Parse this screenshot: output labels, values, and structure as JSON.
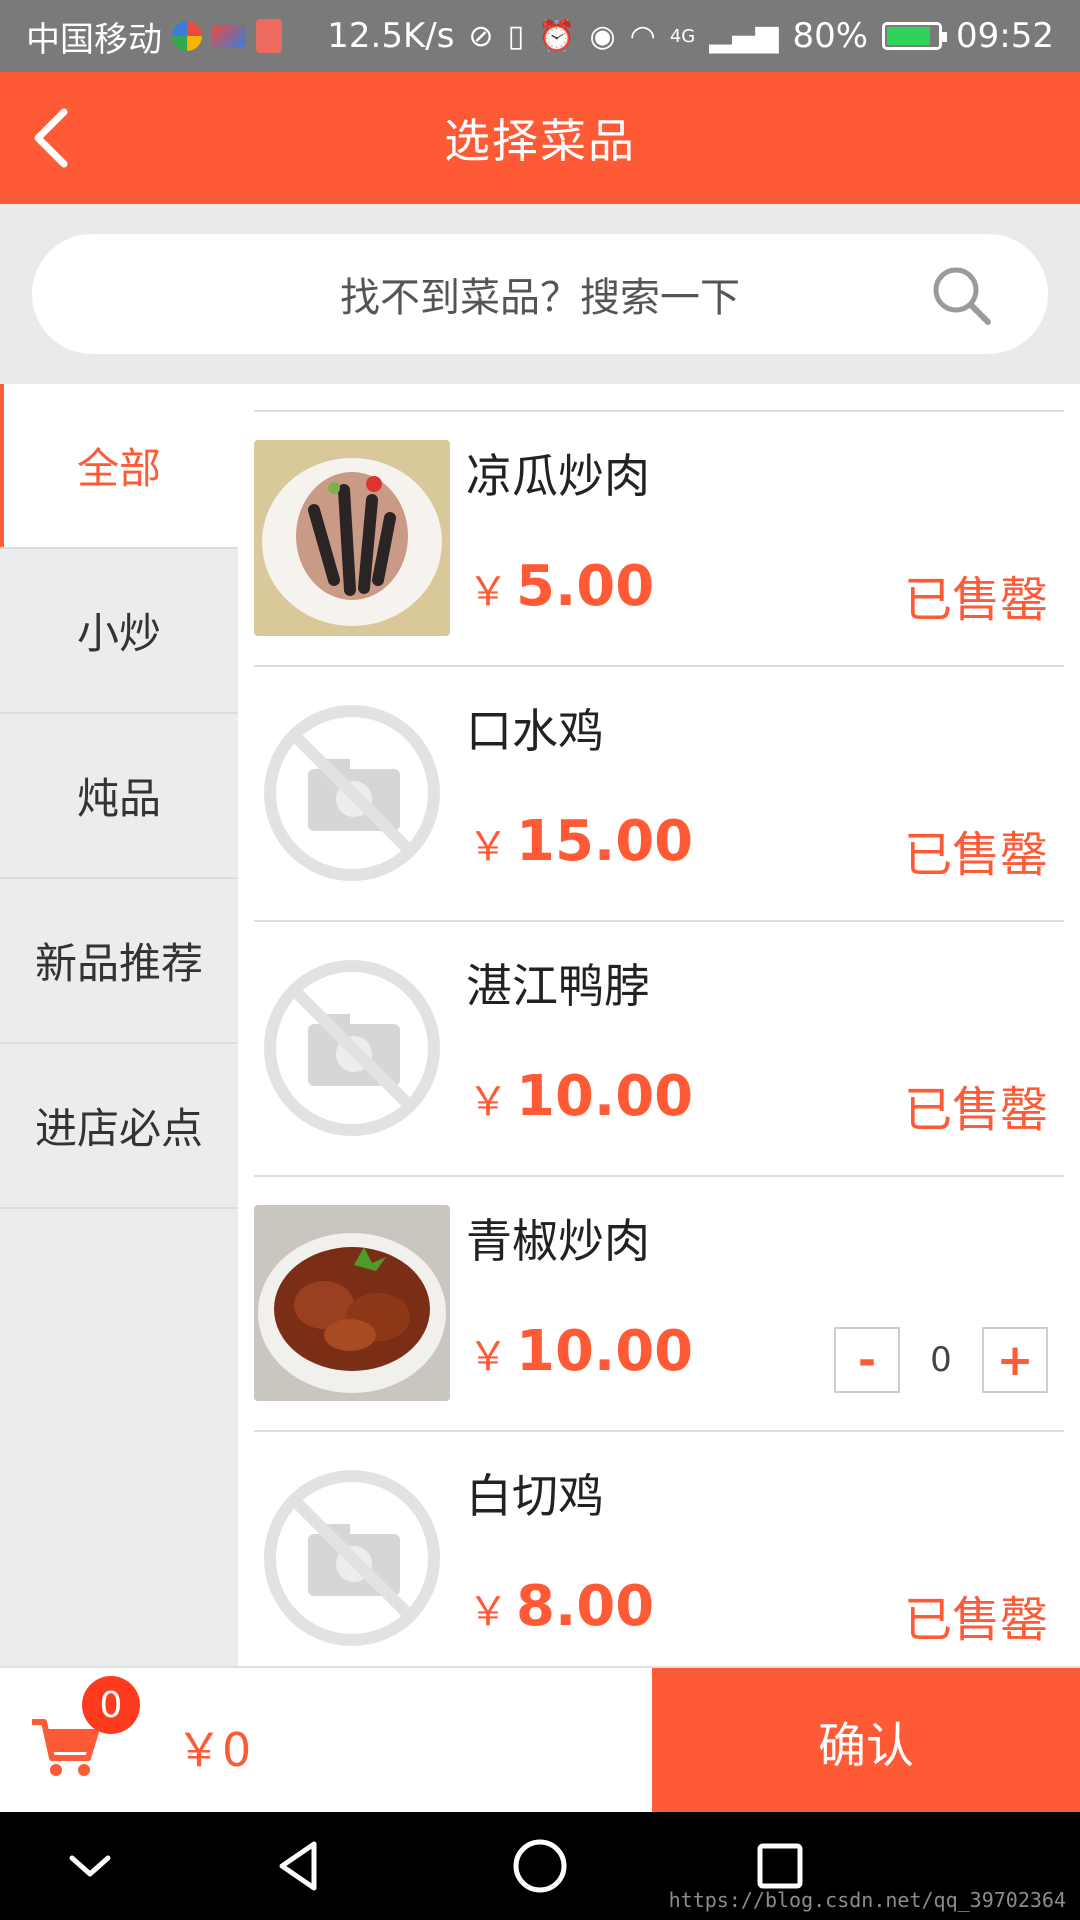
{
  "status_bar": {
    "carrier": "中国移动",
    "net_speed": "12.5K/s",
    "network": "4G",
    "battery": "80%",
    "time": "09:52"
  },
  "header": {
    "title": "选择菜品",
    "back_icon": "chevron-left-icon"
  },
  "search": {
    "placeholder": "找不到菜品？搜索一下",
    "icon": "search-icon"
  },
  "categories": [
    {
      "label": "全部",
      "active": true
    },
    {
      "label": "小炒",
      "active": false
    },
    {
      "label": "炖品",
      "active": false
    },
    {
      "label": "新品推荐",
      "active": false
    },
    {
      "label": "进店必点",
      "active": false
    }
  ],
  "dishes": [
    {
      "name": "凉瓜炒肉",
      "currency": "￥",
      "price": "5.00",
      "status": "已售罄",
      "image": "photo"
    },
    {
      "name": "口水鸡",
      "currency": "￥",
      "price": "15.00",
      "status": "已售罄",
      "image": "placeholder"
    },
    {
      "name": "湛江鸭脖",
      "currency": "￥",
      "price": "10.00",
      "status": "已售罄",
      "image": "placeholder"
    },
    {
      "name": "青椒炒肉",
      "currency": "￥",
      "price": "10.00",
      "status": "",
      "image": "photo",
      "quantity": "0",
      "minus": "-",
      "plus": "+"
    },
    {
      "name": "白切鸡",
      "currency": "￥",
      "price": "8.00",
      "status": "已售罄",
      "image": "placeholder"
    }
  ],
  "cart": {
    "count": "0",
    "total": "￥0",
    "confirm_label": "确认"
  },
  "nav": {
    "icons": [
      "chevron-down-icon",
      "back-triangle-icon",
      "home-circle-icon",
      "recents-square-icon"
    ]
  },
  "watermark": "https://blog.csdn.net/qq_39702364",
  "colors": {
    "accent": "#ff5a36",
    "status_bar": "#7a7a7a",
    "sidebar": "#ececec"
  }
}
